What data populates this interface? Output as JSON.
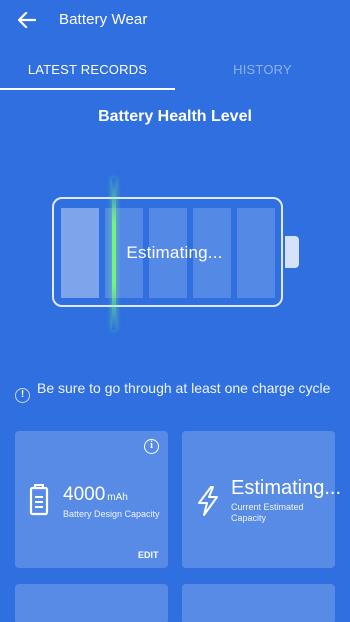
{
  "header": {
    "title": "Battery Wear",
    "back_icon": "arrow-left-icon"
  },
  "tabs": [
    {
      "label": "LATEST RECORDS",
      "active": true
    },
    {
      "label": "HISTORY",
      "active": false
    }
  ],
  "health": {
    "title": "Battery Health Level",
    "status": "Estimating..."
  },
  "notice": {
    "text": "Be sure to go through at least one charge cycle",
    "icon": "exclamation-circle-icon"
  },
  "cards": {
    "design_capacity": {
      "value": "4000",
      "unit": "mAh",
      "label": "Battery Design Capacity",
      "edit_label": "EDIT",
      "icon": "battery-icon",
      "info_icon": "info-icon"
    },
    "estimated_capacity": {
      "value": "Estimating...",
      "label": "Current Estimated Capacity",
      "icon": "lightning-bolt-icon"
    }
  },
  "colors": {
    "background": "#2f6fe0",
    "scan_line": "#78ff78"
  }
}
